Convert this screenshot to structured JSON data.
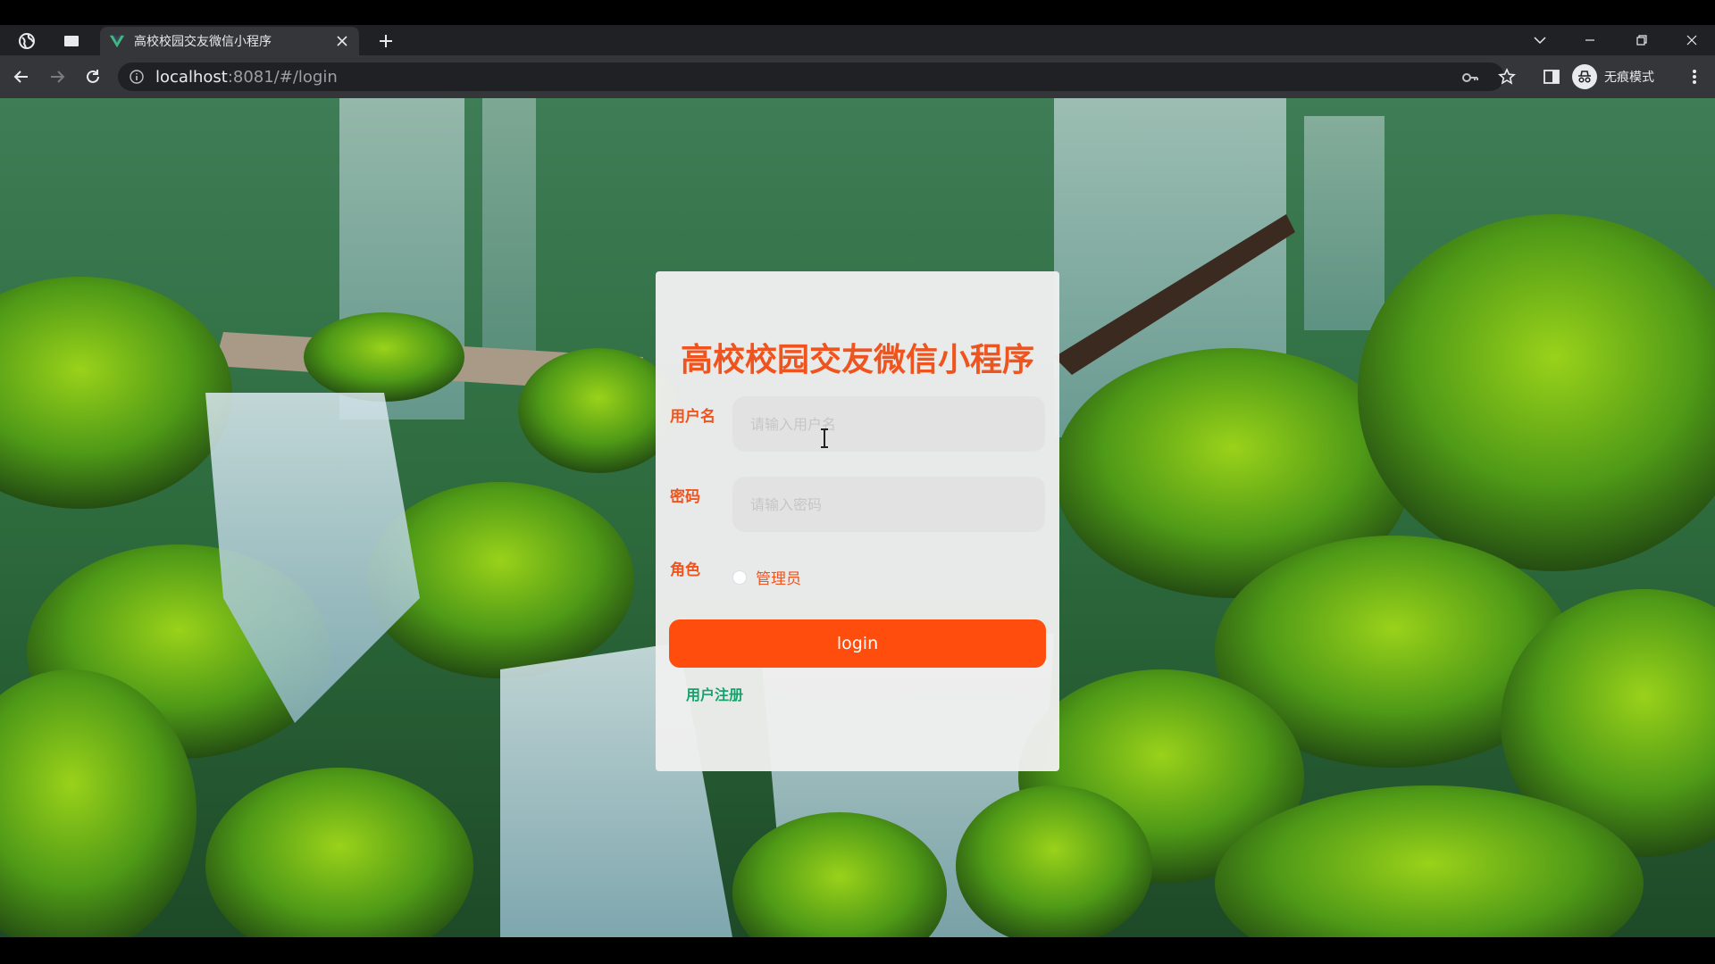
{
  "browser": {
    "tab_title": "高校校园交友微信小程序",
    "url_host": "localhost",
    "url_rest": ":8081/#/login",
    "incognito_label": "无痕模式",
    "icons": [
      "globe-icon",
      "tab-search-icon",
      "vue-favicon-icon",
      "close-tab-icon",
      "new-tab-icon",
      "back-icon",
      "forward-icon",
      "reload-icon",
      "site-info-icon",
      "password-key-icon",
      "bookmark-star-icon",
      "side-panel-icon",
      "incognito-icon",
      "menu-kebab-icon",
      "minimize-icon",
      "restore-icon",
      "close-window-icon"
    ]
  },
  "login": {
    "title": "高校校园交友微信小程序",
    "username_label": "用户名",
    "username_placeholder": "请输入用户名",
    "password_label": "密码",
    "password_placeholder": "请输入密码",
    "role_label": "角色",
    "role_option": "管理员",
    "login_button": "login",
    "register_link": "用户注册"
  },
  "colors": {
    "accent": "#f0541e",
    "button": "#ff4d0d",
    "link": "#14a36b"
  }
}
